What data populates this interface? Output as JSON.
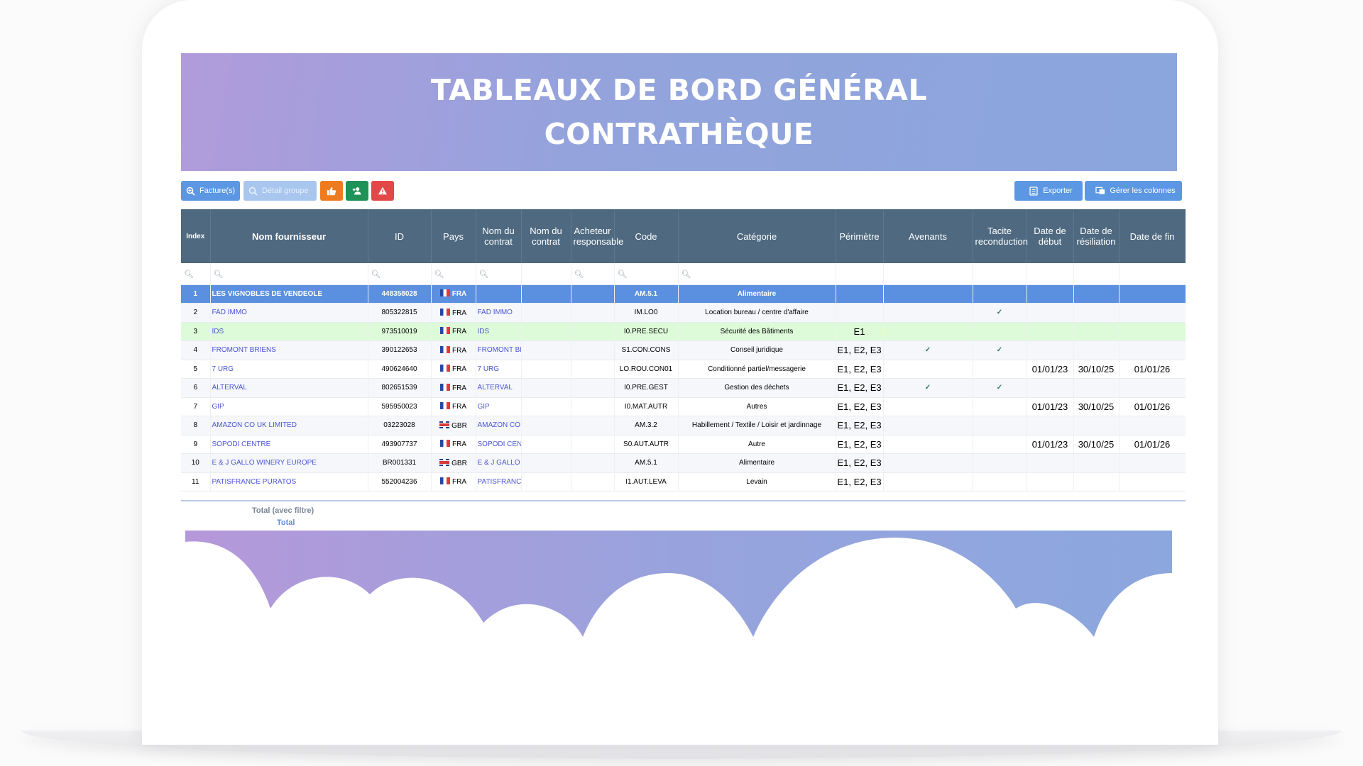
{
  "banner": {
    "line1": "TABLEAUX DE BORD GÉNÉRAL",
    "line2": "CONTRATHÈQUE"
  },
  "toolbar": {
    "factures_label": "Facture(s)",
    "detail_groupe_label": "Détail groupe",
    "exporter_label": "Exporter",
    "gerer_colonnes_label": "Gérer les colonnes"
  },
  "columns": {
    "index": "Index",
    "nom_fournisseur": "Nom fournisseur",
    "id": "ID",
    "pays": "Pays",
    "nom_contrat_1": "Nom du contrat",
    "nom_contrat_2": "Nom du contrat",
    "acheteur": "Acheteur responsable",
    "code": "Code",
    "categorie": "Catégorie",
    "perimetre": "Périmètre",
    "avenants": "Avenants",
    "tacite": "Tacite reconduction",
    "date_debut": "Date de début",
    "date_resiliation": "Date de résiliation",
    "date_fin": "Date de fin"
  },
  "rows": [
    {
      "index": "1",
      "nom": "LES VIGNOBLES DE VENDEOLE",
      "id": "448358028",
      "pays": "FRA",
      "flag": "fr",
      "contrat": "",
      "code": "AM.5.1",
      "categorie": "Alimentaire",
      "perimetre": "",
      "avenants": "",
      "tacite": "",
      "debut": "",
      "resiliation": "",
      "fin": ""
    },
    {
      "index": "2",
      "nom": "FAD IMMO",
      "id": "805322815",
      "pays": "FRA",
      "flag": "fr",
      "contrat": "FAD IMMO",
      "code": "IM.LO0",
      "categorie": "Location bureau / centre d'affaire",
      "perimetre": "",
      "avenants": "",
      "tacite": "✓",
      "debut": "",
      "resiliation": "",
      "fin": ""
    },
    {
      "index": "3",
      "nom": "IDS",
      "id": "973510019",
      "pays": "FRA",
      "flag": "fr",
      "contrat": "IDS",
      "code": "I0.PRE.SECU",
      "categorie": "Sécurité des Bâtiments",
      "perimetre": "E1",
      "avenants": "",
      "tacite": "",
      "debut": "",
      "resiliation": "",
      "fin": ""
    },
    {
      "index": "4",
      "nom": "FROMONT BRIENS",
      "id": "390122653",
      "pays": "FRA",
      "flag": "fr",
      "contrat": "FROMONT BRIENS",
      "code": "S1.CON.CONS",
      "categorie": "Conseil juridique",
      "perimetre": "E1, E2, E3",
      "avenants": "✓",
      "tacite": "✓",
      "debut": "",
      "resiliation": "",
      "fin": ""
    },
    {
      "index": "5",
      "nom": "7 URG",
      "id": "490624640",
      "pays": "FRA",
      "flag": "fr",
      "contrat": "7 URG",
      "code": "LO.ROU.CON01",
      "categorie": "Conditionné partiel/messagerie",
      "perimetre": "E1, E2, E3",
      "avenants": "",
      "tacite": "",
      "debut": "01/01/23",
      "resiliation": "30/10/25",
      "fin": "01/01/26"
    },
    {
      "index": "6",
      "nom": "ALTERVAL",
      "id": "802651539",
      "pays": "FRA",
      "flag": "fr",
      "contrat": "ALTERVAL",
      "code": "I0.PRE.GEST",
      "categorie": "Gestion des déchets",
      "perimetre": "E1, E2, E3",
      "avenants": "✓",
      "tacite": "✓",
      "debut": "",
      "resiliation": "",
      "fin": ""
    },
    {
      "index": "7",
      "nom": "GIP",
      "id": "595950023",
      "pays": "FRA",
      "flag": "fr",
      "contrat": "GIP",
      "code": "I0.MAT.AUTR",
      "categorie": "Autres",
      "perimetre": "E1, E2, E3",
      "avenants": "",
      "tacite": "",
      "debut": "01/01/23",
      "resiliation": "30/10/25",
      "fin": "01/01/26"
    },
    {
      "index": "8",
      "nom": "AMAZON CO UK LIMITED",
      "id": "03223028",
      "pays": "GBR",
      "flag": "gb",
      "contrat": "AMAZON CO UK LIMITED",
      "code": "AM.3.2",
      "categorie": "Habillement / Textile / Loisir et jardinnage",
      "perimetre": "E1, E2, E3",
      "avenants": "",
      "tacite": "",
      "debut": "",
      "resiliation": "",
      "fin": ""
    },
    {
      "index": "9",
      "nom": "SOPODI CENTRE",
      "id": "493907737",
      "pays": "FRA",
      "flag": "fr",
      "contrat": "SOPODI CENTRE",
      "code": "S0.AUT.AUTR",
      "categorie": "Autre",
      "perimetre": "E1, E2, E3",
      "avenants": "",
      "tacite": "",
      "debut": "01/01/23",
      "resiliation": "30/10/25",
      "fin": "01/01/26"
    },
    {
      "index": "10",
      "nom": "E & J GALLO WINERY EUROPE",
      "id": "BR001331",
      "pays": "GBR",
      "flag": "gb",
      "contrat": "E & J GALLO WINERY EUROPE",
      "code": "AM.5.1",
      "categorie": "Alimentaire",
      "perimetre": "E1, E2, E3",
      "avenants": "",
      "tacite": "",
      "debut": "",
      "resiliation": "",
      "fin": ""
    },
    {
      "index": "11",
      "nom": "PATISFRANCE PURATOS",
      "id": "552004236",
      "pays": "FRA",
      "flag": "fr",
      "contrat": "PATISFRANCE PURATOS",
      "code": "I1.AUT.LEVA",
      "categorie": "Levain",
      "perimetre": "E1, E2, E3",
      "avenants": "",
      "tacite": "",
      "debut": "",
      "resiliation": "",
      "fin": ""
    }
  ],
  "footer": {
    "total_filtre": "Total (avec filtre)",
    "total": "Total"
  },
  "colors": {
    "header": "#4e6980",
    "accent": "#5b97e3",
    "selected_row": "#5b8fe0",
    "green_row": "#ddfbd9",
    "link": "#4b55d6"
  }
}
